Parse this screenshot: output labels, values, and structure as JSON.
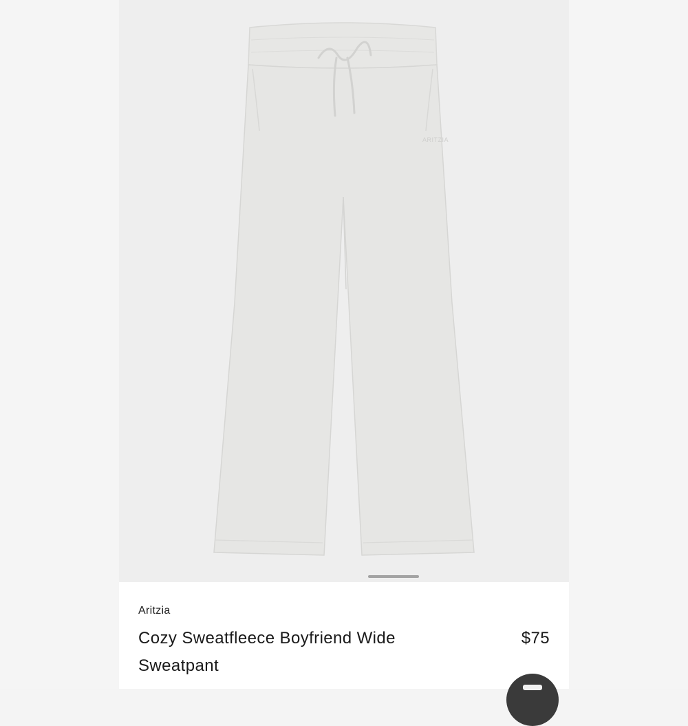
{
  "product": {
    "brand": "Aritzia",
    "name": "Cozy Sweatfleece Boyfriend Wide Sweatpant",
    "price": "$75",
    "garment_logo": "ARITZIA",
    "garment_color": "#e6e6e4"
  },
  "gallery": {
    "indicator": "carousel-indicator"
  },
  "icons": {
    "chat": "chat-icon"
  },
  "colors": {
    "background": "#f4f4f4",
    "panel": "#ffffff",
    "text": "#1a1a1a",
    "fab": "#3a3a3a"
  }
}
